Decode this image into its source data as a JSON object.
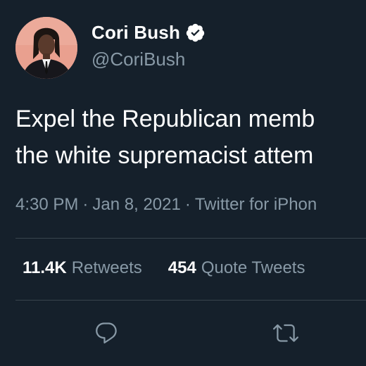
{
  "author": {
    "display_name": "Cori Bush",
    "handle": "@CoriBush",
    "verified": true
  },
  "tweet": {
    "lines": [
      "Expel the Republican memb",
      "the white supremacist attem"
    ]
  },
  "meta": {
    "time": "4:30 PM",
    "date": "Jan 8, 2021",
    "source": "Twitter for iPhon",
    "separator": "·"
  },
  "stats": {
    "retweets_count": "11.4K",
    "retweets_label": "Retweets",
    "quotes_count": "454",
    "quotes_label": "Quote Tweets"
  },
  "actions": [
    {
      "icon": "reply-icon"
    },
    {
      "icon": "retweet-icon"
    }
  ],
  "colors": {
    "background": "#15202b",
    "text_primary": "#ffffff",
    "text_secondary": "#8899a6",
    "divider": "#38444d",
    "verified_badge": "#ffffff",
    "avatar_background": "#e9a08f"
  }
}
